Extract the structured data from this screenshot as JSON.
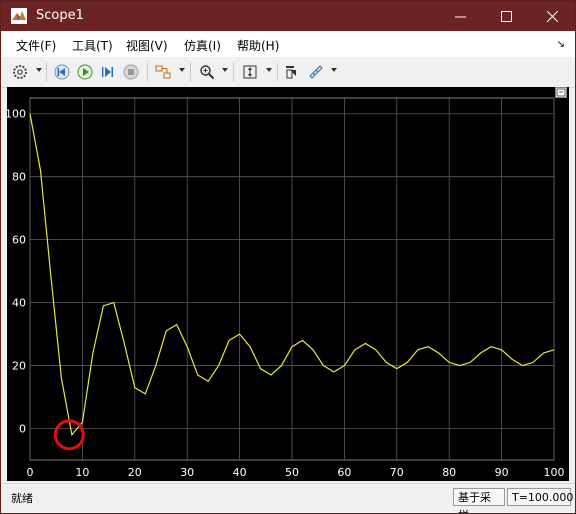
{
  "window": {
    "title": "Scope1"
  },
  "menu": [
    "文件(F)",
    "工具(T)",
    "视图(V)",
    "仿真(I)",
    "帮助(H)"
  ],
  "toolbar": {
    "icons": [
      "settings-icon",
      "step-back-icon",
      "run-icon",
      "step-forward-icon",
      "stop-icon",
      "signal-select-icon",
      "zoom-icon",
      "autoscale-icon",
      "highlight-block-icon",
      "measurement-icon"
    ]
  },
  "status": {
    "text": "就绪",
    "sample_mode": "基于采样",
    "time": "T=100.000"
  },
  "colors": {
    "titlebar": "#6b2323",
    "trace": "#e8e83c",
    "plot_bg": "#000000",
    "grid": "#5a5a5a",
    "highlight_circle": "#e01010"
  },
  "chart_data": {
    "type": "line",
    "xlim": [
      0,
      100
    ],
    "ylim": [
      -10,
      105
    ],
    "x_ticks": [
      "0",
      "10",
      "20",
      "30",
      "40",
      "50",
      "60",
      "70",
      "80",
      "90",
      "100"
    ],
    "y_ticks": [
      "0",
      "20",
      "40",
      "60",
      "80",
      "100"
    ],
    "grid": true,
    "series": [
      {
        "x": [
          0,
          2,
          4,
          6,
          8,
          10,
          12,
          14,
          16,
          18,
          20,
          22,
          24,
          26,
          28,
          30,
          32,
          34,
          36,
          38,
          40,
          42,
          44,
          46,
          48,
          50,
          52,
          54,
          56,
          58,
          60,
          62,
          64,
          66,
          68,
          70,
          72,
          74,
          76,
          78,
          80,
          82,
          84,
          86,
          88,
          90,
          92,
          94,
          96,
          98,
          100
        ],
        "y": [
          100,
          82,
          48,
          16,
          -2,
          2,
          24,
          39,
          40,
          27,
          13,
          11,
          20,
          31,
          33,
          26,
          17,
          15,
          20,
          28,
          30,
          26,
          19,
          17,
          20,
          26,
          28,
          25,
          20,
          18,
          20,
          25,
          27,
          25,
          21,
          19,
          21,
          25,
          26,
          24,
          21,
          20,
          21,
          24,
          26,
          25,
          22,
          20,
          21,
          24,
          25
        ]
      }
    ],
    "annotation": {
      "type": "circle",
      "x": 7.5,
      "y": -2
    }
  }
}
